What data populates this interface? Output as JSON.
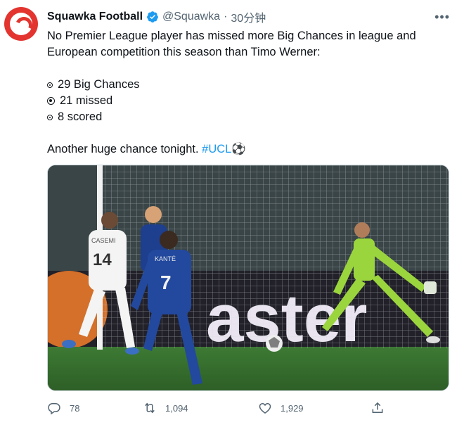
{
  "tweet": {
    "author_name": "Squawka Football",
    "handle": "@Squawka",
    "separator": "·",
    "time": "30分钟",
    "text_line1": "No Premier League player has missed more Big Chances in league and European competition this season than Timo Werner:",
    "stat1": "29 Big Chances",
    "stat2": "21 missed",
    "stat3": "8 scored",
    "closing": "Another huge chance tonight. ",
    "hashtag": "#UCL",
    "emoji": "⚽"
  },
  "media": {
    "board_text": "aster",
    "player1_number": "14",
    "player1_name": "CASEMI",
    "player2_number": "7",
    "player2_name": "KANTÉ"
  },
  "actions": {
    "replies": "78",
    "retweets": "1,094",
    "likes": "1,929"
  },
  "colors": {
    "accent": "#1d9bf0",
    "brand": "#e3342f"
  }
}
